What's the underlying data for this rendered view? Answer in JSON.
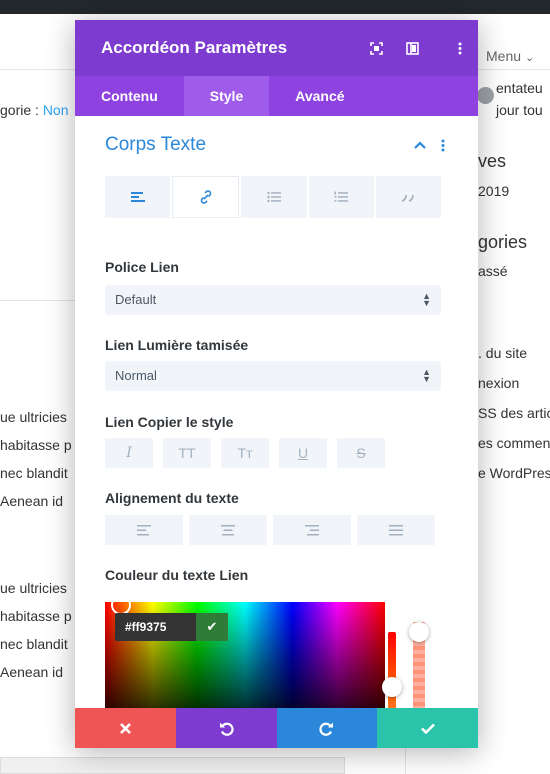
{
  "background": {
    "menu_label": "Menu",
    "category_prefix": "gorie : ",
    "category_link": "Non",
    "sidebar_text_1": "entateu",
    "sidebar_text_2": "jour tou",
    "archives_heading": "ves",
    "archives_year": "2019",
    "categories_heading": "gories",
    "categories_item": "assé",
    "meta_items": [
      ". du site",
      "nexion",
      "SS des artic",
      "es comment",
      "e WordPress"
    ],
    "paragraph_lines_1": [
      "ue ultricies",
      " habitasse p",
      " nec blandit",
      " Aenean id"
    ],
    "paragraph_lines_2": [
      "ue ultricies",
      " habitasse p",
      " nec blandit",
      " Aenean id"
    ]
  },
  "modal": {
    "title": "Accordéon Paramètres",
    "tabs": [
      {
        "label": "Contenu",
        "active": false
      },
      {
        "label": "Style",
        "active": true
      },
      {
        "label": "Avancé",
        "active": false
      }
    ],
    "section_title": "Corps Texte",
    "fields": {
      "police_label": "Police Lien",
      "police_value": "Default",
      "lumiere_label": "Lien Lumière tamisée",
      "lumiere_value": "Normal",
      "copier_label": "Lien Copier le style",
      "style_buttons": [
        "I",
        "TT",
        "Tт",
        "U",
        "S"
      ],
      "alignement_label": "Alignement du texte",
      "couleur_label": "Couleur du texte Lien"
    },
    "color_picker": {
      "hex": "#ff9375",
      "current_color": "#ff9375"
    },
    "colors": {
      "header": "#7e3bd0",
      "tabs": "#8e42e0",
      "accent": "#2b87da",
      "cancel": "#ef5555",
      "save": "#29c4a9"
    }
  }
}
